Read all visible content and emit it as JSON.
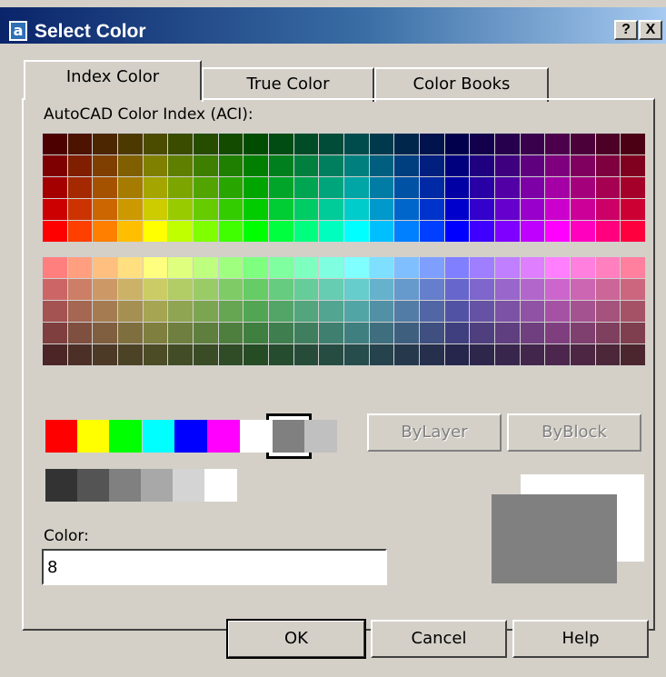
{
  "window": {
    "icon": "a",
    "title": "Select Color",
    "help_glyph": "?",
    "close_glyph": "X"
  },
  "tabs": [
    {
      "label": "Index Color",
      "active": true
    },
    {
      "label": "True Color",
      "active": false
    },
    {
      "label": "Color Books",
      "active": false
    }
  ],
  "aci": {
    "label": "AutoCAD Color Index (ACI):",
    "upper_rows": [
      [
        "#4c0000",
        "#4c1300",
        "#4c2600",
        "#4c3900",
        "#4c4c00",
        "#394c00",
        "#264c00",
        "#134c00",
        "#004c00",
        "#004c13",
        "#004c26",
        "#004c39",
        "#004c4c",
        "#00394c",
        "#00264c",
        "#00134c",
        "#00004c",
        "#13004c",
        "#26004c",
        "#39004c",
        "#4c004c",
        "#4c0039",
        "#4c0026",
        "#4c0013"
      ],
      [
        "#7f0000",
        "#7f1f00",
        "#7f3f00",
        "#7f5f00",
        "#7f7f00",
        "#5f7f00",
        "#3f7f00",
        "#1f7f00",
        "#007f00",
        "#007f1f",
        "#007f3f",
        "#007f5f",
        "#007f7f",
        "#005f7f",
        "#003f7f",
        "#001f7f",
        "#00007f",
        "#1f007f",
        "#3f007f",
        "#5f007f",
        "#7f007f",
        "#7f005f",
        "#7f003f",
        "#7f001f"
      ],
      [
        "#a50000",
        "#a52900",
        "#a55200",
        "#a57c00",
        "#a5a500",
        "#7ca500",
        "#52a500",
        "#29a500",
        "#00a500",
        "#00a529",
        "#00a552",
        "#00a57c",
        "#00a5a5",
        "#007ca5",
        "#0052a5",
        "#0029a5",
        "#0000a5",
        "#2900a5",
        "#5200a5",
        "#7c00a5",
        "#a500a5",
        "#a5007c",
        "#a50052",
        "#a50029"
      ],
      [
        "#cc0000",
        "#cc3300",
        "#cc6600",
        "#cc9900",
        "#cccc00",
        "#99cc00",
        "#66cc00",
        "#33cc00",
        "#00cc00",
        "#00cc33",
        "#00cc66",
        "#00cc99",
        "#00cccc",
        "#0099cc",
        "#0066cc",
        "#0033cc",
        "#0000cc",
        "#3300cc",
        "#6600cc",
        "#9900cc",
        "#cc00cc",
        "#cc0099",
        "#cc0066",
        "#cc0033"
      ],
      [
        "#ff0000",
        "#ff3f00",
        "#ff7f00",
        "#ffbf00",
        "#ffff00",
        "#bfff00",
        "#7fff00",
        "#3fff00",
        "#00ff00",
        "#00ff3f",
        "#00ff7f",
        "#00ffbf",
        "#00ffff",
        "#00bfff",
        "#007fff",
        "#003fff",
        "#0000ff",
        "#3f00ff",
        "#7f00ff",
        "#bf00ff",
        "#ff00ff",
        "#ff00bf",
        "#ff007f",
        "#ff003f"
      ]
    ],
    "lower_rows": [
      [
        "#ff7f7f",
        "#ff9f7f",
        "#ffbf7f",
        "#ffdf7f",
        "#ffff7f",
        "#dfff7f",
        "#bfff7f",
        "#9fff7f",
        "#7fff7f",
        "#7fff9f",
        "#7fffbf",
        "#7fffdf",
        "#7fffff",
        "#7fdfff",
        "#7fbfff",
        "#7f9fff",
        "#7f7fff",
        "#9f7fff",
        "#bf7fff",
        "#df7fff",
        "#ff7fff",
        "#ff7fdf",
        "#ff7fbf",
        "#ff7f9f"
      ],
      [
        "#cc6666",
        "#cc7f66",
        "#cc9966",
        "#ccb266",
        "#cccc66",
        "#b2cc66",
        "#99cc66",
        "#7fcc66",
        "#66cc66",
        "#66cc7f",
        "#66cc99",
        "#66ccb2",
        "#66cccc",
        "#66b2cc",
        "#6699cc",
        "#667fcc",
        "#6666cc",
        "#7f66cc",
        "#9966cc",
        "#b266cc",
        "#cc66cc",
        "#cc66b2",
        "#cc6699",
        "#cc667f"
      ],
      [
        "#a55252",
        "#a56652",
        "#a57c52",
        "#a59052",
        "#a5a552",
        "#90a552",
        "#7ca552",
        "#66a552",
        "#52a552",
        "#52a566",
        "#52a57c",
        "#52a590",
        "#52a5a5",
        "#5290a5",
        "#527ca5",
        "#5266a5",
        "#5252a5",
        "#6652a5",
        "#7c52a5",
        "#9052a5",
        "#a552a5",
        "#a55290",
        "#a5527c",
        "#a55266"
      ],
      [
        "#7f3f3f",
        "#7f4f3f",
        "#7f5f3f",
        "#7f6f3f",
        "#7f7f3f",
        "#6f7f3f",
        "#5f7f3f",
        "#4f7f3f",
        "#3f7f3f",
        "#3f7f4f",
        "#3f7f5f",
        "#3f7f6f",
        "#3f7f7f",
        "#3f6f7f",
        "#3f5f7f",
        "#3f4f7f",
        "#3f3f7f",
        "#4f3f7f",
        "#5f3f7f",
        "#6f3f7f",
        "#7f3f7f",
        "#7f3f6f",
        "#7f3f5f",
        "#7f3f4f"
      ],
      [
        "#4c2626",
        "#4c2f26",
        "#4c3926",
        "#4c4226",
        "#4c4c26",
        "#424c26",
        "#394c26",
        "#2f4c26",
        "#264c26",
        "#264c2f",
        "#264c39",
        "#264c42",
        "#264c4c",
        "#26424c",
        "#26394c",
        "#262f4c",
        "#26264c",
        "#2f264c",
        "#39264c",
        "#42264c",
        "#4c264c",
        "#4c2642",
        "#4c2639",
        "#4c262f"
      ]
    ]
  },
  "standard_colors": [
    "#ff0000",
    "#ffff00",
    "#00ff00",
    "#00ffff",
    "#0000ff",
    "#ff00ff",
    "#ffffff",
    "#808080",
    "#c0c0c0"
  ],
  "gray_shades": [
    "#333333",
    "#545454",
    "#808080",
    "#a8a8a8",
    "#d4d4d4",
    "#ffffff"
  ],
  "selected_index": 7,
  "bylayer_label": "ByLayer",
  "byblock_label": "ByBlock",
  "color_field": {
    "label": "Color:",
    "value": "8"
  },
  "preview": {
    "new_color": "#ffffff",
    "current_color": "#808080"
  },
  "buttons": {
    "ok": "OK",
    "cancel": "Cancel",
    "help": "Help"
  }
}
